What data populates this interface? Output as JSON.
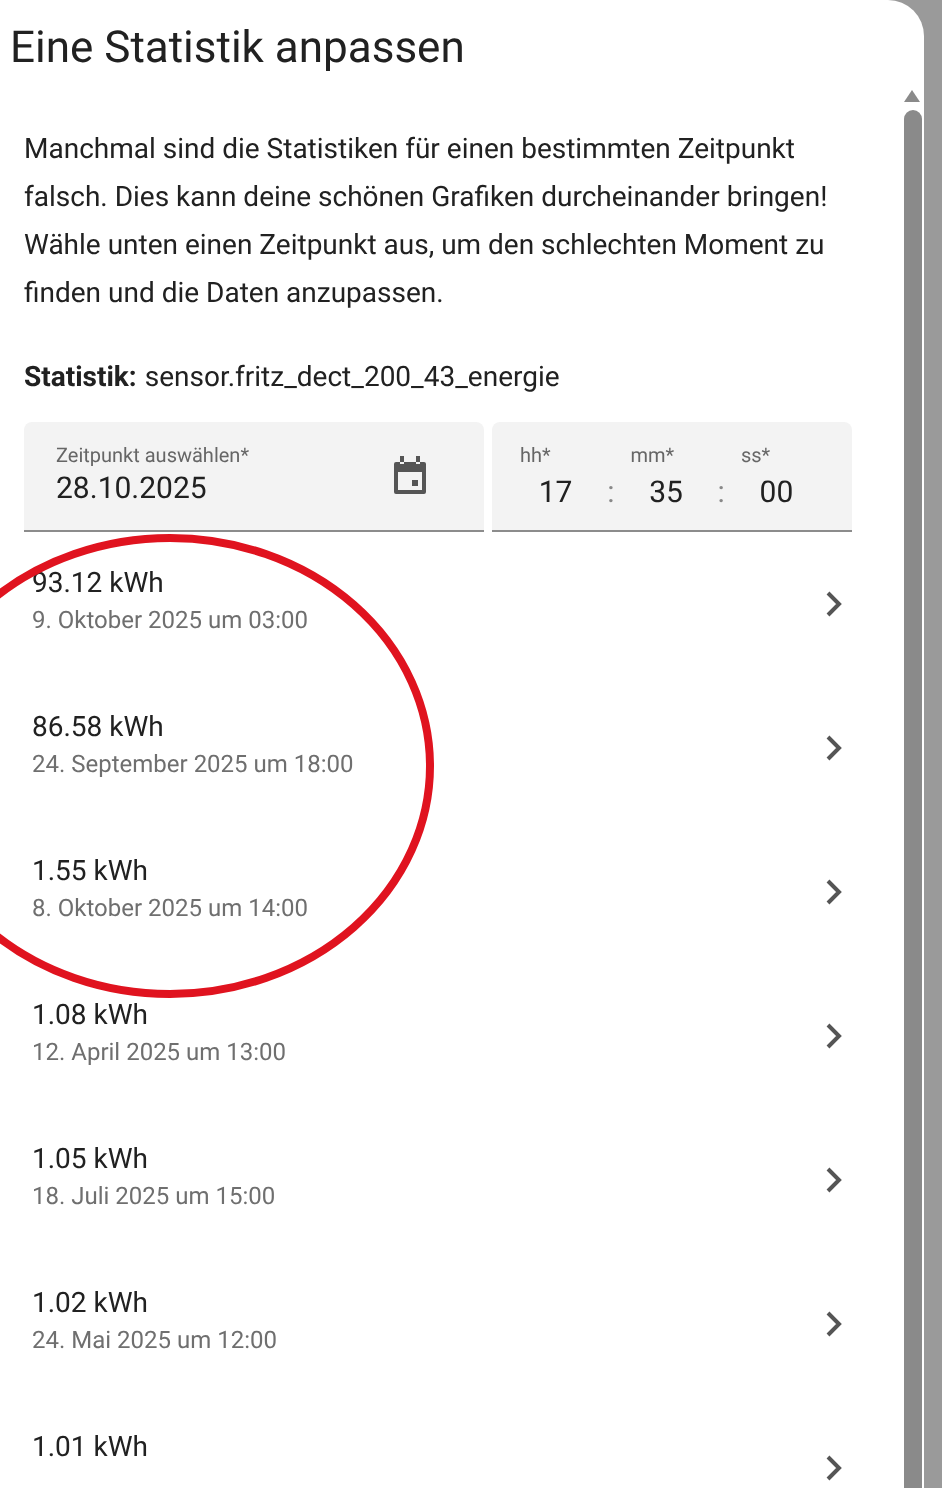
{
  "dialog": {
    "title": "Eine Statistik anpassen",
    "description": "Manchmal sind die Statistiken für einen bestimmten Zeitpunkt falsch. Dies kann deine schönen Grafiken durcheinander bringen! Wähle unten einen Zeitpunkt aus, um den schlechten Moment zu finden und die Daten anzupassen.",
    "statistic": {
      "label": "Statistik:",
      "value": "sensor.fritz_dect_200_43_energie"
    },
    "date_field": {
      "label": "Zeitpunkt auswählen*",
      "value": "28.10.2025"
    },
    "time_field": [
      {
        "label": "hh*",
        "value": "17"
      },
      {
        "label": "mm*",
        "value": "35"
      },
      {
        "label": "ss*",
        "value": "00"
      }
    ],
    "time_separator": ":",
    "rows": [
      {
        "value": "93.12 kWh",
        "date": "9. Oktober 2025 um 03:00"
      },
      {
        "value": "86.58 kWh",
        "date": "24. September 2025 um 18:00"
      },
      {
        "value": "1.55 kWh",
        "date": "8. Oktober 2025 um 14:00"
      },
      {
        "value": "1.08 kWh",
        "date": "12. April 2025 um 13:00"
      },
      {
        "value": "1.05 kWh",
        "date": "18. Juli 2025 um 15:00"
      },
      {
        "value": "1.02 kWh",
        "date": "24. Mai 2025 um 12:00"
      },
      {
        "value": "1.01 kWh"
      }
    ]
  },
  "annotation": {
    "kind": "circle",
    "color": "#e0131f"
  }
}
